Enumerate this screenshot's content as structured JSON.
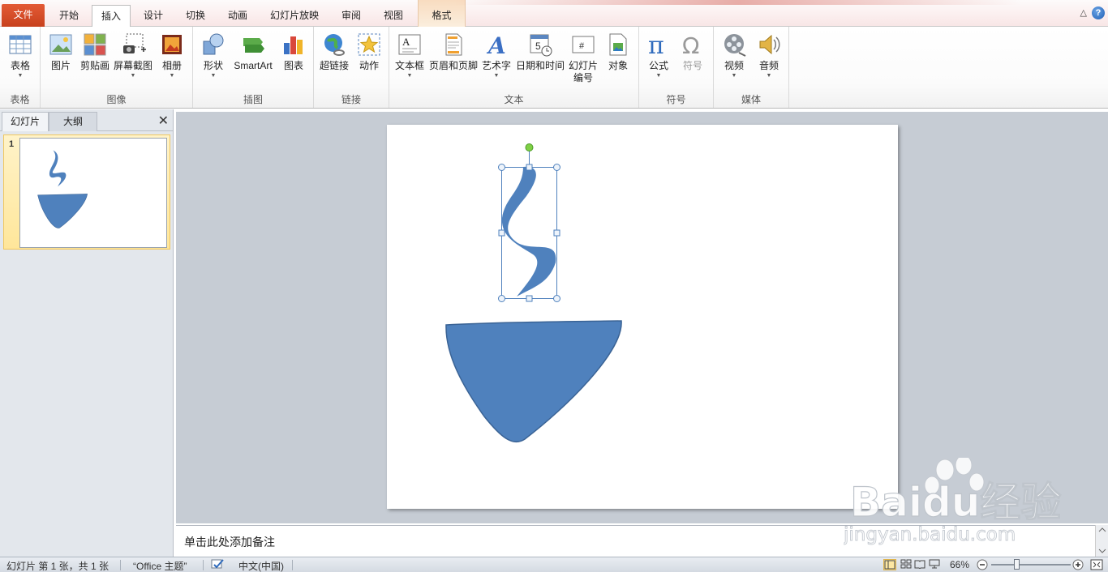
{
  "ribbon_tabs": {
    "file": "文件",
    "home": "开始",
    "insert": "插入",
    "design": "设计",
    "transitions": "切换",
    "animations": "动画",
    "slideshow": "幻灯片放映",
    "review": "审阅",
    "view": "视图",
    "format": "格式"
  },
  "window_controls": {
    "minimize_ribbon": "△",
    "help": "?"
  },
  "groups": {
    "tables": {
      "label": "表格",
      "table": "表格"
    },
    "images": {
      "label": "图像",
      "picture": "图片",
      "clipart": "剪贴画",
      "screenshot": "屏幕截图",
      "album": "相册"
    },
    "illustrations": {
      "label": "插图",
      "shapes": "形状",
      "smartart": "SmartArt",
      "chart": "图表"
    },
    "links": {
      "label": "链接",
      "hyperlink": "超链接",
      "action": "动作"
    },
    "text": {
      "label": "文本",
      "textbox": "文本框",
      "header_footer": "页眉和页脚",
      "wordart": "艺术字",
      "datetime": "日期和时间",
      "slide_number_line1": "幻灯片",
      "slide_number_line2": "编号",
      "object": "对象"
    },
    "symbols": {
      "label": "符号",
      "equation": "公式",
      "symbol": "符号"
    },
    "media": {
      "label": "媒体",
      "video": "视频",
      "audio": "音频"
    }
  },
  "left_pane": {
    "tab_slides": "幻灯片",
    "tab_outline": "大纲",
    "close": "✕",
    "slide_number": "1"
  },
  "notes": {
    "placeholder": "单击此处添加备注"
  },
  "status_bar": {
    "slide_info": "幻灯片 第 1 张，共 1 张",
    "theme": "“Office 主题”",
    "language": "中文(中国)",
    "zoom": "66%"
  },
  "colors": {
    "shape_fill": "#4f81bd",
    "shape_stroke": "#3a6395",
    "file_tab": "#d24a26",
    "selection_handle": "#4f81bd",
    "rotation_handle": "#7fd045"
  },
  "watermark": {
    "brand": "Baidu经验",
    "url": "jingyan.baidu.com"
  }
}
